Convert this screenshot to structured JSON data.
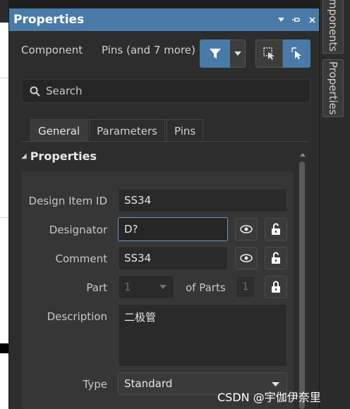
{
  "panel": {
    "title": "Properties",
    "title_buttons": {
      "menu": "▾",
      "pin": "⊣",
      "close": "×"
    }
  },
  "component": {
    "label": "Component",
    "filter_text": "Pins (and 7 more)"
  },
  "search": {
    "placeholder": "Search"
  },
  "tabs": [
    {
      "label": "General",
      "active": true
    },
    {
      "label": "Parameters",
      "active": false
    },
    {
      "label": "Pins",
      "active": false
    }
  ],
  "section": {
    "title": "Properties"
  },
  "fields": {
    "design_item_id": {
      "label": "Design Item ID",
      "value": "SS34"
    },
    "designator": {
      "label": "Designator",
      "value": "D?"
    },
    "comment": {
      "label": "Comment",
      "value": "SS34"
    },
    "part": {
      "label": "Part",
      "value": "1",
      "of_parts_label": "of Parts",
      "of_parts_value": "1"
    },
    "description": {
      "label": "Description",
      "value": "二极管"
    },
    "type": {
      "label": "Type",
      "value": "Standard"
    }
  },
  "side_tabs": [
    {
      "label": "Components",
      "visible_text": "mponents"
    },
    {
      "label": "Properties",
      "visible_text": "Properties"
    }
  ],
  "watermark": "CSDN @宇伽伊奈里",
  "colors": {
    "accent": "#4a7aa8",
    "panel_bg": "#2d2d2d",
    "field_bg": "#2a2a2a",
    "focus_border": "#6a95c4"
  }
}
